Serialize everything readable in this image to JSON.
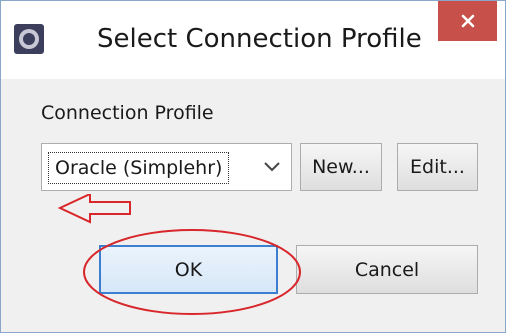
{
  "window": {
    "title": "Select Connection Profile",
    "close_glyph": "×",
    "app_icon": "eclipse-app-icon",
    "close_icon": "close-icon"
  },
  "form": {
    "section_label": "Connection Profile",
    "profile_select": {
      "selected": "Oracle (Simplehr)",
      "icon": "chevron-down-icon"
    },
    "new_button_label": "New...",
    "edit_button_label": "Edit..."
  },
  "actions": {
    "ok_label": "OK",
    "cancel_label": "Cancel"
  },
  "annotations": {
    "arrow_color": "#d8262b",
    "ellipse_color": "#d8262b"
  },
  "colors": {
    "close_button": "#c7504a",
    "focus_border": "#3c7fd1",
    "dialog_background": "#f0f0f0"
  }
}
